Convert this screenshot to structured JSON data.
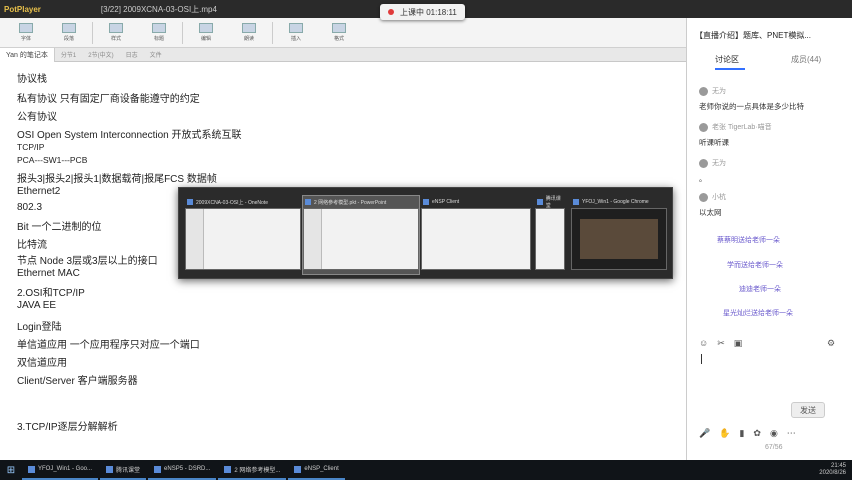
{
  "player": {
    "logo": "PotPlayer",
    "file_title": "[3/22] 2009XCNA-03-OSI上.mp4",
    "status": "上课中 01:18:11"
  },
  "ribbon": {
    "groups": [
      "字体",
      "段落",
      "样式",
      "标题",
      "编辑",
      "朗读",
      "插入",
      "格式"
    ]
  },
  "doc_tabs": {
    "active": "Yan 的笔记本",
    "others": [
      "分节1",
      "2节(中文)",
      "日志",
      "文件"
    ]
  },
  "doc_lines": [
    "协议栈",
    "私有协议 只有固定厂商设备能遵守的约定",
    "公有协议",
    "OSI Open System Interconnection 开放式系统互联",
    "TCP/IP",
    "PCA---SW1---PCB",
    "报头3|报头2|报头1|数据载荷|报尾FCS    数据帧",
    "Ethernet2",
    "802.3",
    "Bit 一个二进制的位",
    "比特流",
    "节点 Node 3层或3层以上的接口",
    "Ethernet MAC",
    "2.OSI和TCP/IP",
    "JAVA EE",
    "Login登陆",
    "单信道应用 一个应用程序只对应一个端口",
    "双信道应用",
    "Client/Server 客户端服务器",
    "3.TCP/IP逐层分解解析"
  ],
  "switcher": {
    "windows": [
      "2009XCNA-03-OSI上 - OneNote",
      "2 网络参考模型.pkt - PowerPoint",
      "eNSP Client",
      "腾讯课堂",
      "YFOJ_Win1 - Google Chrome"
    ]
  },
  "panel": {
    "title": "【直播介绍】题库、PNET模拟...",
    "tab_discussion": "讨论区",
    "tab_members": "成员(44)",
    "messages": [
      {
        "user": "无为",
        "text": "老师你说的一点具体是多少比特"
      },
      {
        "user": "老张 TigerLab·喵音",
        "text": "听课听课"
      },
      {
        "user": "无为",
        "text": "。"
      },
      {
        "user": "小杭",
        "text": "以太网"
      }
    ],
    "gifts": [
      "蔡蔡明送给老师一朵",
      "学而送给老师一朵",
      "迪迪老师一朵",
      "星光灿烂送给老师一朵"
    ],
    "send_label": "发送",
    "pager": "67/56"
  },
  "taskbar": {
    "items": [
      "YFOJ_Win1 - Goo...",
      "腾讯课堂",
      "eNSP5 - DSRD...",
      "2 网络参考模型...",
      "eNSP_Client"
    ],
    "time": "21:45",
    "date": "2020/8/26"
  }
}
